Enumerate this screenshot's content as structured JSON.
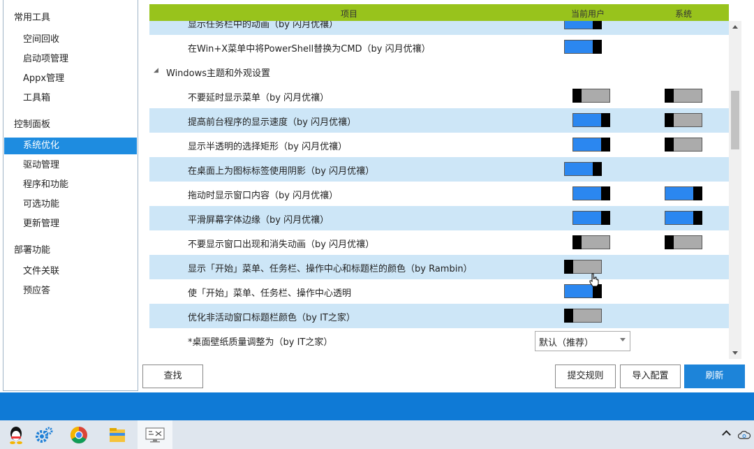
{
  "sidebar": {
    "groups": [
      {
        "label": "常用工具",
        "items": [
          "空间回收",
          "启动项管理",
          "Appx管理",
          "工具箱"
        ]
      },
      {
        "label": "控制面板",
        "items": [
          "系统优化",
          "驱动管理",
          "程序和功能",
          "可选功能",
          "更新管理"
        ]
      },
      {
        "label": "部署功能",
        "items": [
          "文件关联",
          "预应答"
        ]
      }
    ],
    "active_item": "系统优化"
  },
  "grid": {
    "headers": {
      "item": "项目",
      "current_user": "当前用户",
      "system": "系统"
    },
    "rows": [
      {
        "label": "显示任务栏中的动画（by 闪月优禳）",
        "type": "setting",
        "user": "on",
        "system": null,
        "alt": true
      },
      {
        "label": "在Win+X菜单中将PowerShell替换为CMD（by 闪月优禳）",
        "type": "setting",
        "user": "on",
        "system": null,
        "alt": false
      },
      {
        "label": "Windows主题和外观设置",
        "type": "group"
      },
      {
        "label": "不要延时显示菜单（by 闪月优禳）",
        "type": "setting",
        "user": "off",
        "system": "off",
        "alt": false
      },
      {
        "label": "提高前台程序的显示速度（by 闪月优禳）",
        "type": "setting",
        "user": "on",
        "system": "off",
        "alt": true
      },
      {
        "label": "显示半透明的选择矩形（by 闪月优禳）",
        "type": "setting",
        "user": "on",
        "system": "off",
        "alt": false
      },
      {
        "label": "在桌面上为图标标签使用阴影（by 闪月优禳）",
        "type": "setting",
        "user": "on",
        "system": null,
        "alt": true
      },
      {
        "label": "拖动时显示窗口内容（by 闪月优禳）",
        "type": "setting",
        "user": "on",
        "system": "on",
        "alt": false
      },
      {
        "label": "平滑屏幕字体边缘（by 闪月优禳）",
        "type": "setting",
        "user": "on",
        "system": "on",
        "alt": true
      },
      {
        "label": "不要显示窗口出现和消失动画（by 闪月优禳）",
        "type": "setting",
        "user": "off",
        "system": "off",
        "alt": false
      },
      {
        "label": "显示「开始」菜单、任务栏、操作中心和标题栏的颜色（by Rambin）",
        "type": "setting",
        "user": "off",
        "system": null,
        "alt": true
      },
      {
        "label": "使「开始」菜单、任务栏、操作中心透明",
        "type": "setting",
        "user": "on",
        "system": null,
        "alt": false
      },
      {
        "label": "优化非活动窗口标题栏颜色（by IT之家）",
        "type": "setting",
        "user": "off",
        "system": null,
        "alt": true
      },
      {
        "label": "*桌面壁纸质量调整为（by IT之家）",
        "type": "select",
        "value": "默认（推荐）",
        "alt": false
      }
    ]
  },
  "buttons": {
    "find": "查找",
    "submit_rules": "提交规则",
    "import_config": "导入配置",
    "refresh": "刷新"
  },
  "colors": {
    "header": "#98c31c",
    "alt_row": "#cde6f7",
    "toggle_on": "#2b87f0",
    "accent": "#1d84d9"
  },
  "taskbar": {
    "icons": [
      "qq-icon",
      "settings-gear-icon",
      "chrome-icon",
      "file-explorer-icon",
      "dism-tool-icon"
    ]
  }
}
